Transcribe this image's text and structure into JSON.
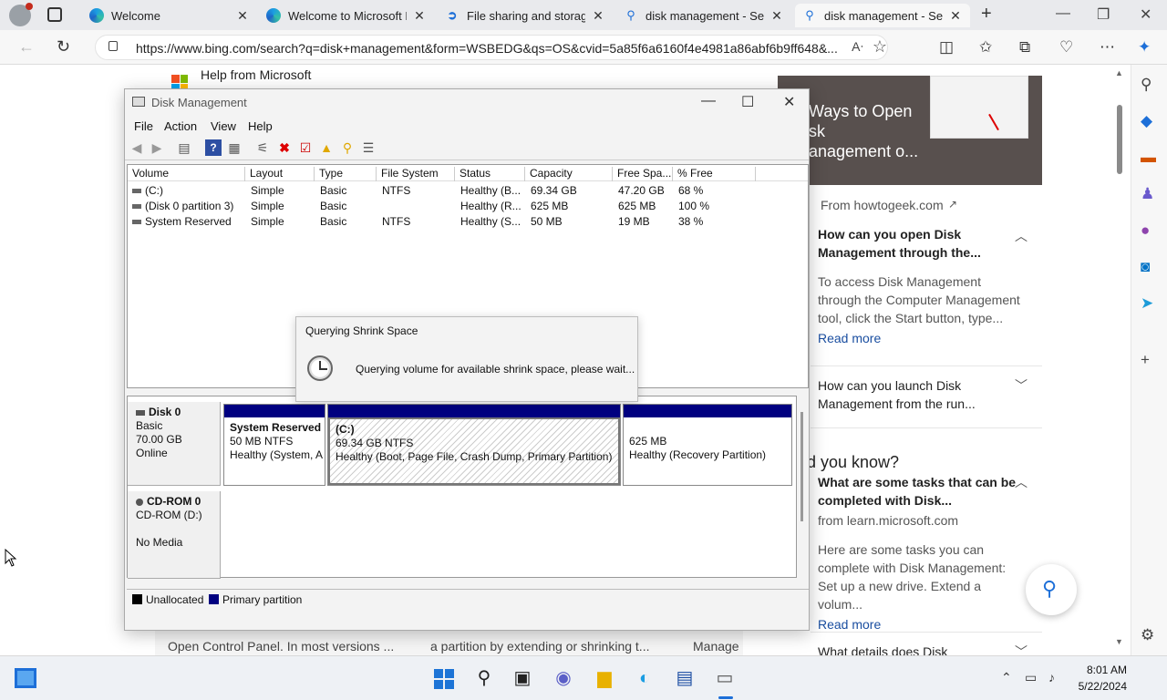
{
  "browser": {
    "tabs": [
      {
        "label": "Welcome",
        "icon": "edge-icon"
      },
      {
        "label": "Welcome to Microsoft Ed",
        "icon": "edge-icon"
      },
      {
        "label": "File sharing and storage",
        "icon": "share-icon"
      },
      {
        "label": "disk management - Sear",
        "icon": "search-icon"
      },
      {
        "label": "disk management - Sear",
        "icon": "search-icon"
      }
    ],
    "url": "https://www.bing.com/search?q=disk+management&form=WSBEDG&qs=OS&cvid=5a85f6a6160f4e4981a86abf6b9ff648&..."
  },
  "page": {
    "help_title": "Help from Microsoft",
    "bottom_snippets": [
      "Open Control Panel. In most versions ...",
      "a partition by extending or shrinking t...",
      "Manage"
    ],
    "right_panel": {
      "hero_title": "Ways to Open\nsk\nanagement o...",
      "source1": "From howtogeek.com",
      "faq1": {
        "question": "How can you open Disk Management through the...",
        "answer": "To access Disk Management through the Computer Management tool, click the Start button, type...",
        "more": "Read more"
      },
      "faq2": {
        "question": "How can you launch Disk Management from the run..."
      },
      "did_you_know": "d you know?",
      "faq3": {
        "question": "What are some tasks that can be completed with Disk...",
        "source": "from learn.microsoft.com",
        "answer": "Here are some tasks you can complete with Disk Management: Set up a new drive. Extend a volum...",
        "more": "Read more"
      },
      "faq4": {
        "question": "What details does Disk"
      }
    }
  },
  "disk_management": {
    "title": "Disk Management",
    "menu": [
      "File",
      "Action",
      "View",
      "Help"
    ],
    "columns": [
      "Volume",
      "Layout",
      "Type",
      "File System",
      "Status",
      "Capacity",
      "Free Spa...",
      "% Free"
    ],
    "volumes": [
      {
        "volume": "(C:)",
        "layout": "Simple",
        "type": "Basic",
        "fs": "NTFS",
        "status": "Healthy (B...",
        "capacity": "69.34 GB",
        "free": "47.20 GB",
        "pct": "68 %"
      },
      {
        "volume": "(Disk 0 partition 3)",
        "layout": "Simple",
        "type": "Basic",
        "fs": "",
        "status": "Healthy (R...",
        "capacity": "625 MB",
        "free": "625 MB",
        "pct": "100 %"
      },
      {
        "volume": "System Reserved",
        "layout": "Simple",
        "type": "Basic",
        "fs": "NTFS",
        "status": "Healthy (S...",
        "capacity": "50 MB",
        "free": "19 MB",
        "pct": "38 %"
      }
    ],
    "disk0": {
      "name": "Disk 0",
      "type": "Basic",
      "size": "70.00 GB",
      "state": "Online",
      "partitions": [
        {
          "name": "System Reserved",
          "size": "50 MB NTFS",
          "status": "Healthy (System, A"
        },
        {
          "name": "(C:)",
          "size": "69.34 GB NTFS",
          "status": "Healthy (Boot, Page File, Crash Dump, Primary Partition)"
        },
        {
          "name": "",
          "size": "625 MB",
          "status": "Healthy (Recovery Partition)"
        }
      ]
    },
    "cdrom": {
      "name": "CD-ROM 0",
      "drive": "CD-ROM (D:)",
      "media": "No Media"
    },
    "legend": {
      "unallocated": "Unallocated",
      "primary": "Primary partition"
    }
  },
  "dialog": {
    "title": "Querying Shrink Space",
    "message": "Querying volume for available shrink space, please wait..."
  },
  "taskbar": {
    "time": "8:01 AM",
    "date": "5/22/2024"
  },
  "colors": {
    "primary_partition": "#000080",
    "unallocated": "#000000",
    "accent": "#1d6fd8"
  }
}
